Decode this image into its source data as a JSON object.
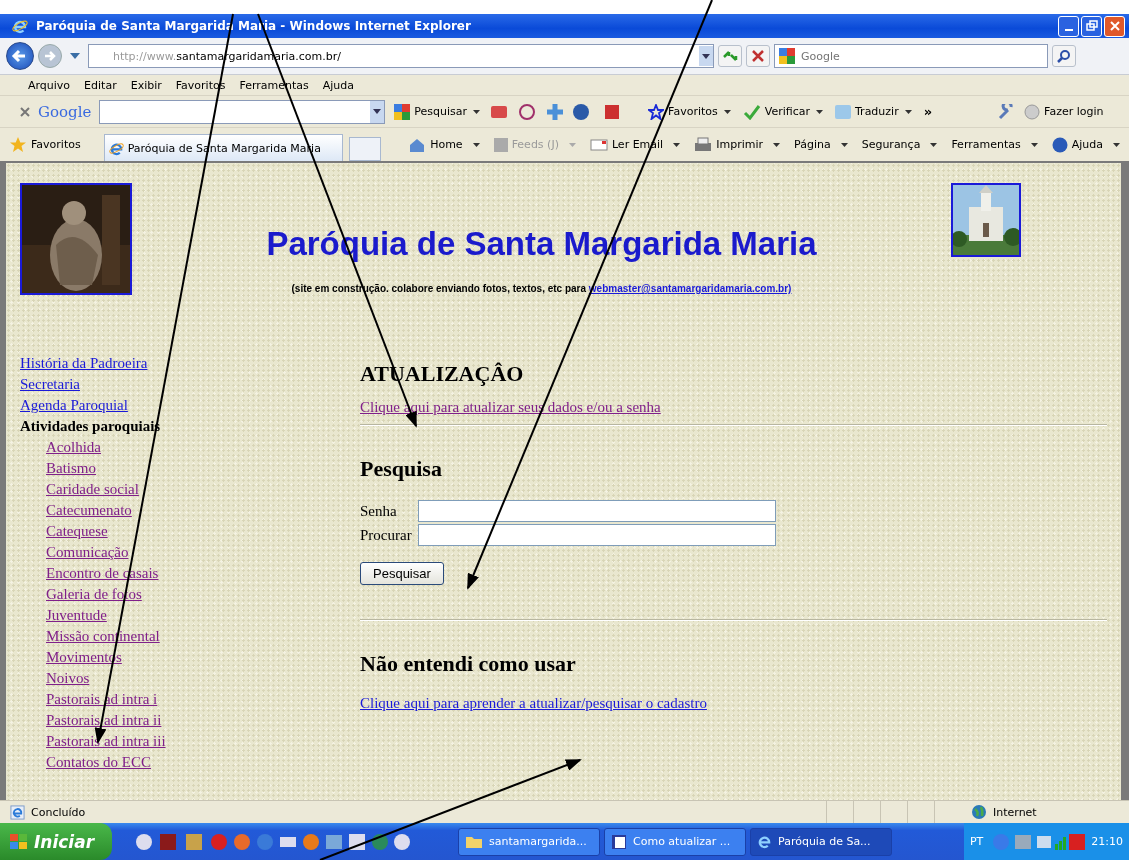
{
  "window": {
    "title": "Paróquia de Santa Margarida Maria - Windows Internet Explorer"
  },
  "address": {
    "url_prefix": "http://www.",
    "url_host": "santamargaridamaria.com.br/",
    "search_placeholder": "Google"
  },
  "menu": [
    "Arquivo",
    "Editar",
    "Exibir",
    "Favoritos",
    "Ferramentas",
    "Ajuda"
  ],
  "google_bar": {
    "logo": "Google",
    "items": [
      {
        "kind": "search",
        "label": "Pesquisar"
      },
      {
        "kind": "star",
        "label": "Favoritos"
      },
      {
        "kind": "check",
        "label": "Verificar"
      },
      {
        "kind": "translate",
        "label": "Traduzir"
      },
      {
        "kind": "more",
        "label": "»"
      },
      {
        "kind": "login",
        "label": "Fazer login"
      }
    ]
  },
  "favorites_bar": {
    "label": "Favoritos",
    "tab": "Paróquia de Santa Margarida Maria",
    "commands": [
      {
        "kind": "home",
        "label": "Home",
        "disabled": false
      },
      {
        "kind": "feed",
        "label": "Feeds (J)",
        "disabled": true
      },
      {
        "kind": "mail",
        "label": "Ler Email",
        "disabled": false
      },
      {
        "kind": "print",
        "label": "Imprimir",
        "disabled": false
      },
      {
        "kind": "menu",
        "label": "Página",
        "disabled": false
      },
      {
        "kind": "menu",
        "label": "Segurança",
        "disabled": false
      },
      {
        "kind": "menu",
        "label": "Ferramentas",
        "disabled": false
      },
      {
        "kind": "help",
        "label": "Ajuda",
        "disabled": false
      }
    ]
  },
  "page": {
    "title": "Paróquia de Santa Margarida Maria",
    "note": "(site em construção. colabore enviando fotos, textos, etc para",
    "note_link": "webmaster@santamargaridamaria.com.br)",
    "sidebar": [
      {
        "kind": "link",
        "label": "História da Padroeira",
        "visited": false
      },
      {
        "kind": "link",
        "label": "Secretaria",
        "visited": false
      },
      {
        "kind": "link",
        "label": "Agenda Paroquial",
        "visited": false
      },
      {
        "kind": "heading",
        "label": "Atividades paroquiais",
        "children": [
          {
            "label": "Acolhida",
            "visited": true
          },
          {
            "label": "Batismo",
            "visited": true
          },
          {
            "label": "Caridade social",
            "visited": true
          },
          {
            "label": "Catecumenato",
            "visited": true
          },
          {
            "label": "Catequese",
            "visited": true
          },
          {
            "label": "Comunicação",
            "visited": true
          },
          {
            "label": "Encontro de casais",
            "visited": true
          },
          {
            "label": "Galeria de fotos",
            "visited": true
          },
          {
            "label": "Juventude",
            "visited": true
          },
          {
            "label": "Missão continental",
            "visited": true
          },
          {
            "label": "Movimentos",
            "visited": true
          },
          {
            "label": "Noivos",
            "visited": true
          },
          {
            "label": "Pastorais ad intra i",
            "visited": true
          },
          {
            "label": "Pastorais ad intra ii",
            "visited": true
          },
          {
            "label": "Pastorais ad intra iii",
            "visited": true
          },
          {
            "label": "Contatos do ECC",
            "visited": true
          }
        ]
      }
    ],
    "update": {
      "heading": "ATUALIZAÇÂO",
      "link": "Clique aqui para atualizar seus dados e/ou a senha",
      "visited": true
    },
    "search": {
      "heading": "Pesquisa",
      "fields": [
        {
          "label": "Senha"
        },
        {
          "label": "Procurar"
        }
      ],
      "button": "Pesquisar"
    },
    "help": {
      "heading": "Não entendi como usar",
      "link": "Clique aqui para aprender a atualizar/pesquisar o cadastro",
      "visited": false
    }
  },
  "status_bar": {
    "status": "Concluído",
    "zone": "Internet"
  },
  "taskbar": {
    "start": "Iniciar",
    "tasks": [
      {
        "kind": "folder",
        "label": "santamargarida...",
        "selected": false
      },
      {
        "kind": "word",
        "label": "Como atualizar ...",
        "selected": false
      },
      {
        "kind": "ie",
        "label": "Paróquia de Sa...",
        "selected": true
      }
    ],
    "language": "PT",
    "time": "21:10"
  }
}
